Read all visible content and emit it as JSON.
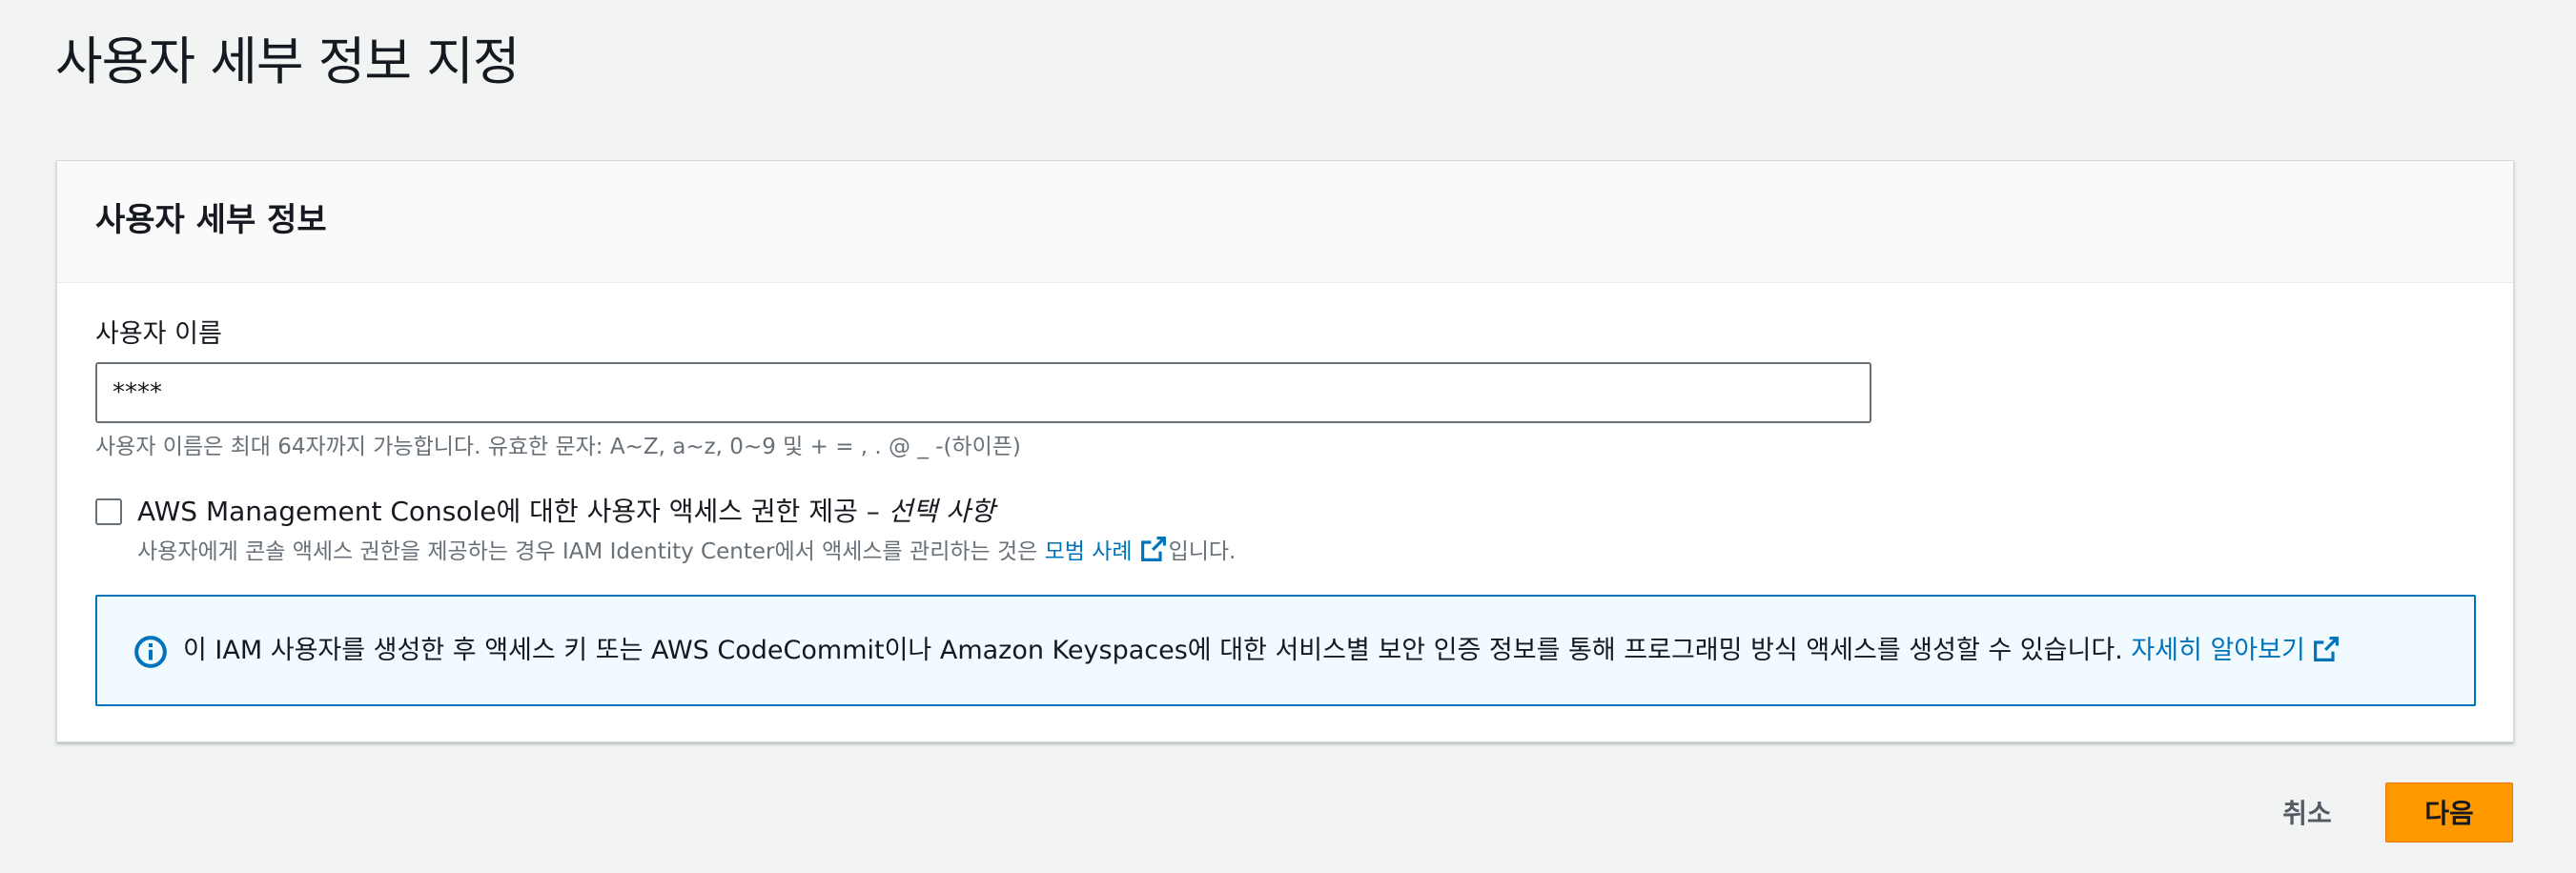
{
  "page": {
    "title": "사용자 세부 정보 지정"
  },
  "panel": {
    "title": "사용자 세부 정보"
  },
  "username_field": {
    "label": "사용자 이름",
    "value": "****",
    "hint": "사용자 이름은 최대 64자까지 가능합니다. 유효한 문자: A~Z, a~z, 0~9 및 + = , . @ _ -(하이픈)"
  },
  "console_access": {
    "checked": false,
    "label": "AWS Management Console에 대한 사용자 액세스 권한 제공",
    "separator": " – ",
    "optional": "선택 사항",
    "description_prefix": "사용자에게 콘솔 액세스 권한을 제공하는 경우 IAM Identity Center에서 액세스를 관리하는 것은",
    "description_link": "모범 사례",
    "description_suffix": "입니다."
  },
  "info_alert": {
    "icon": "info-icon",
    "text": "이 IAM 사용자를 생성한 후 액세스 키 또는 AWS CodeCommit이나 Amazon Keyspaces에 대한 서비스별 보안 인증 정보를 통해 프로그래밍 방식 액세스를 생성할 수 있습니다.",
    "link": "자세히 알아보기"
  },
  "actions": {
    "cancel": "취소",
    "next": "다음"
  },
  "colors": {
    "accent": "#ff9900",
    "link": "#0073bb",
    "info_background": "#f1faff"
  }
}
